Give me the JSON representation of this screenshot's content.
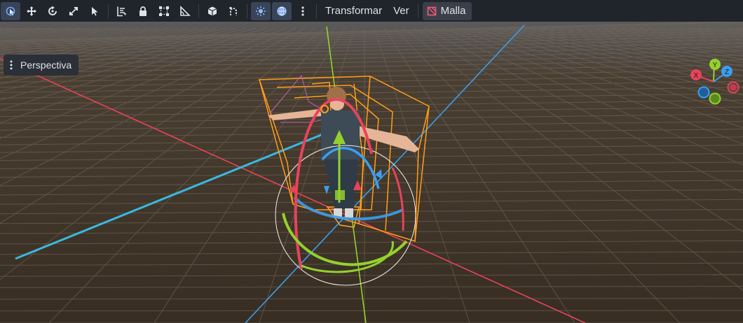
{
  "toolbar": {
    "tools": [
      {
        "name": "select-mode",
        "icon": "select-cursor-icon",
        "active": true
      },
      {
        "name": "move-mode",
        "icon": "move-arrows-icon"
      },
      {
        "name": "rotate-mode",
        "icon": "rotate-icon"
      },
      {
        "name": "scale-mode",
        "icon": "scale-icon"
      },
      {
        "name": "list-select-mode",
        "icon": "pointer-icon"
      },
      {
        "name": "ruler-mode",
        "icon": "ruler-icon"
      },
      {
        "name": "lock",
        "icon": "lock-icon"
      },
      {
        "name": "group",
        "icon": "group-icon"
      },
      {
        "name": "snap",
        "icon": "snap-icon"
      },
      {
        "name": "preview",
        "icon": "cube-icon"
      },
      {
        "name": "bone",
        "icon": "bone-icon"
      }
    ],
    "menus": {
      "transform": "Transformar",
      "view": "Ver"
    },
    "mesh_button": "Malla"
  },
  "viewport": {
    "perspective_label": "Perspectiva",
    "gizmo": {
      "x": "X",
      "y": "Y",
      "z": "Z"
    }
  },
  "colors": {
    "background": "#3a3026",
    "axis_x": "#e8435a",
    "axis_y": "#94d12e",
    "axis_z": "#3a9ff0",
    "selection": "#ff9e1a"
  }
}
